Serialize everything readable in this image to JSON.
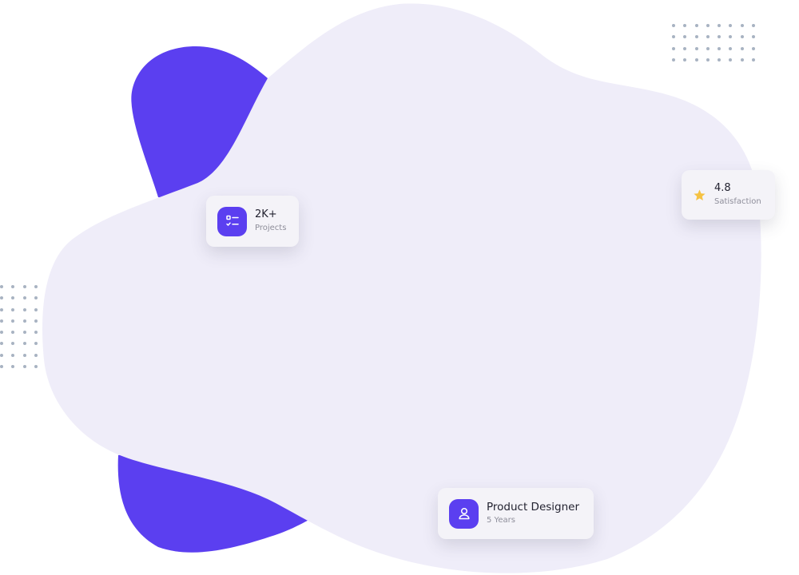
{
  "colors": {
    "accent": "#5b3ff0",
    "blob": "#efedf9",
    "dots": "#a8b3c2",
    "star": "#f5c242",
    "card_bg": "#f4f3f8"
  },
  "stats": [
    {
      "value": "2K+",
      "label": "Projects",
      "icon": "checklist-icon"
    },
    {
      "value": "4.8",
      "label": "Satisfaction",
      "icon": "star-icon"
    },
    {
      "value": "Product Designer",
      "label": "5 Years",
      "icon": "user-icon"
    }
  ]
}
